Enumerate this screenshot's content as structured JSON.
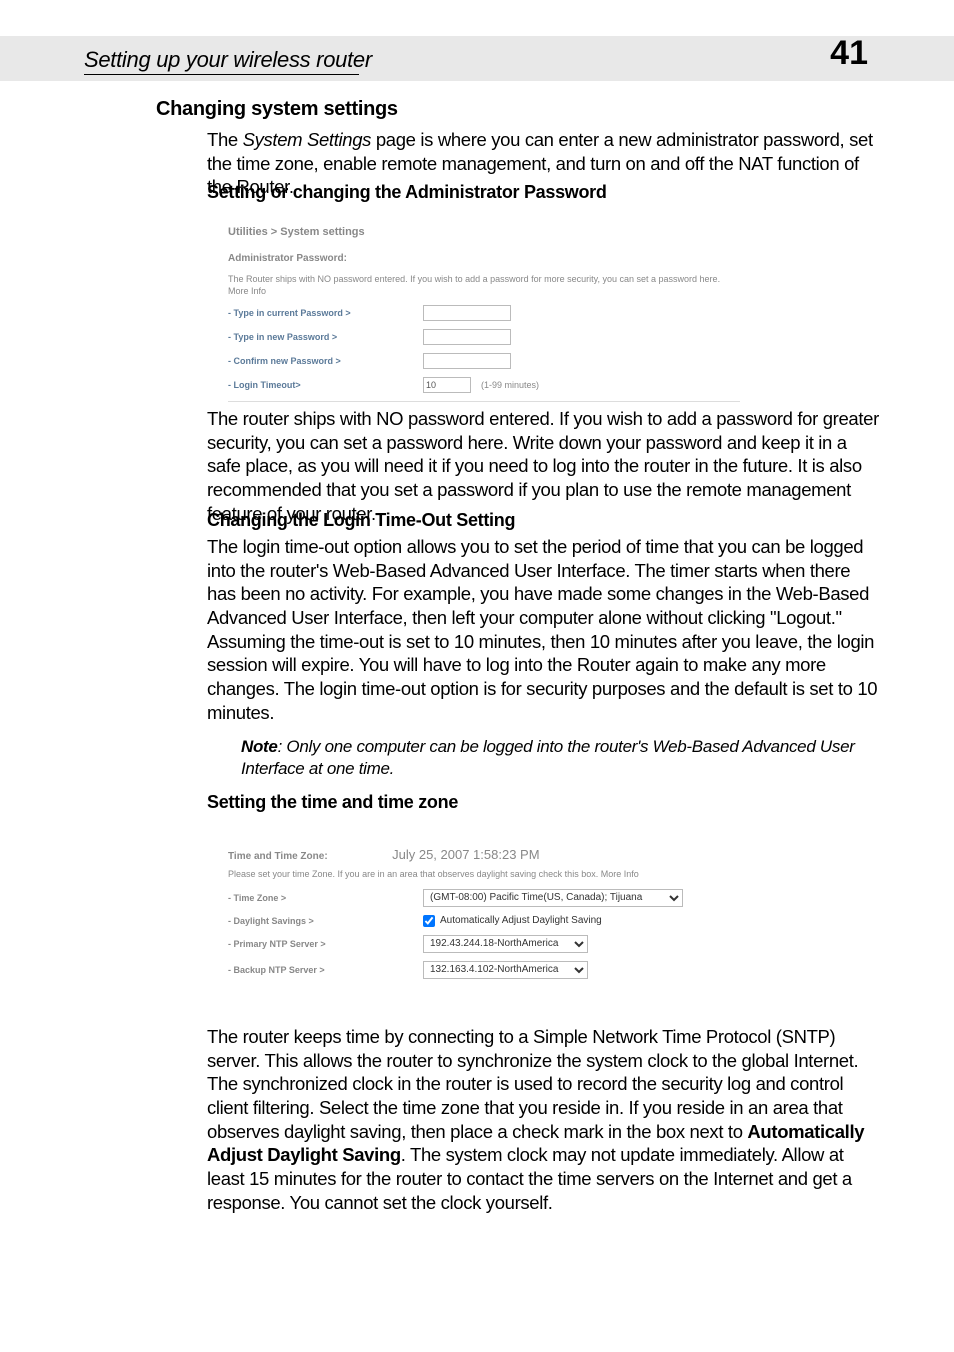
{
  "header": {
    "title": "Setting up your wireless router",
    "page": "41"
  },
  "h3": "Changing system settings",
  "intro": "The System Settings page is where you can enter a new administrator password, set the time zone, enable remote management, and turn on and off the NAT function of the Router.",
  "h4a": "Setting or changing the Administrator Password",
  "ss1": {
    "crumb": "Utilities > System settings",
    "apw": "Administrator Password:",
    "desc": "The Router ships with NO password entered. If you wish to add a password for more security, you can set a password here. More Info",
    "r1": "- Type in current Password >",
    "r2": "- Type in new Password >",
    "r3": "- Confirm new Password >",
    "r4": "- Login Timeout>",
    "timeout_value": "10",
    "timeout_unit": "(1-99 minutes)"
  },
  "para1": "The router ships with NO password entered. If you wish to add a password for greater security, you can set a password here. Write down your password and keep it in a safe place, as you will need it if you need to log into the router in the future. It is also recommended that you set a password if you plan to use the remote management feature of your router.",
  "h4b": "Changing the Login Time-Out Setting",
  "para2": "The login time-out option allows you to set the period of time that you can be logged into the router's Web-Based Advanced User Interface. The timer starts when there has been no activity. For example, you have made some changes in the Web-Based Advanced User Interface, then left your computer alone without clicking \"Logout.\" Assuming the time-out is set to 10 minutes, then 10 minutes after you leave, the login session will expire. You will have to log into the Router again to make any more changes. The login time-out option is for security purposes and the default is set to 10 minutes.",
  "note": {
    "label": "Note",
    "text": ": Only one computer can be logged into the router's Web-Based Advanced User Interface at one time."
  },
  "h4c": "Setting the time and time zone",
  "ss2": {
    "label": "Time and Time Zone:",
    "datetime": "July 25, 2007    1:58:23 PM",
    "desc": "Please set your time Zone. If you are in an area that observes daylight saving check this box. More Info",
    "r1": "- Time Zone >",
    "tz_value": "(GMT-08:00) Pacific Time(US, Canada); Tijuana",
    "r2": "- Daylight Savings >",
    "ds_label": "Automatically Adjust Daylight Saving",
    "r3": "- Primary NTP Server >",
    "ntp1": "192.43.244.18-NorthAmerica",
    "r4": "- Backup NTP Server >",
    "ntp2": "132.163.4.102-NorthAmerica"
  },
  "para3a": "The router keeps time by connecting to a Simple Network Time Protocol (SNTP) server. This allows the router to synchronize the system clock to the global Internet. The synchronized clock in the router is used to record the security log and control client filtering. Select the time zone that you reside in. If you reside in an area that observes daylight saving, then place a check mark in the box next to ",
  "para3bold": "Automatically Adjust Daylight Saving",
  "para3b": ". The system clock may not update immediately. Allow at least 15 minutes for the router to contact the time servers on the Internet and get a response. You cannot set the clock yourself."
}
